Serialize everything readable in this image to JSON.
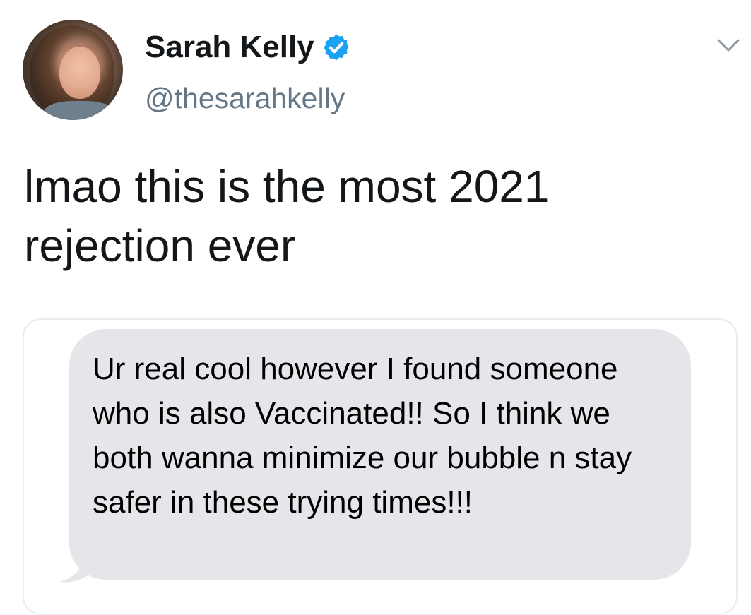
{
  "author": {
    "display_name": "Sarah Kelly",
    "handle": "@thesarahkelly",
    "verified": true
  },
  "tweet": {
    "text": "lmao this is the most 2021 rejection ever"
  },
  "attached_image": {
    "message_text": "Ur real cool however I found someone who is also Vaccinated!! So I think we both wanna minimize our bubble n stay safer in these trying times!!!"
  },
  "icons": {
    "verified_badge": "verified-check-icon",
    "menu": "chevron-down-icon"
  },
  "colors": {
    "verified_blue": "#1da1f2",
    "handle_gray": "#657786",
    "bubble_gray": "#e5e5ea",
    "text_dark": "#14171a"
  }
}
